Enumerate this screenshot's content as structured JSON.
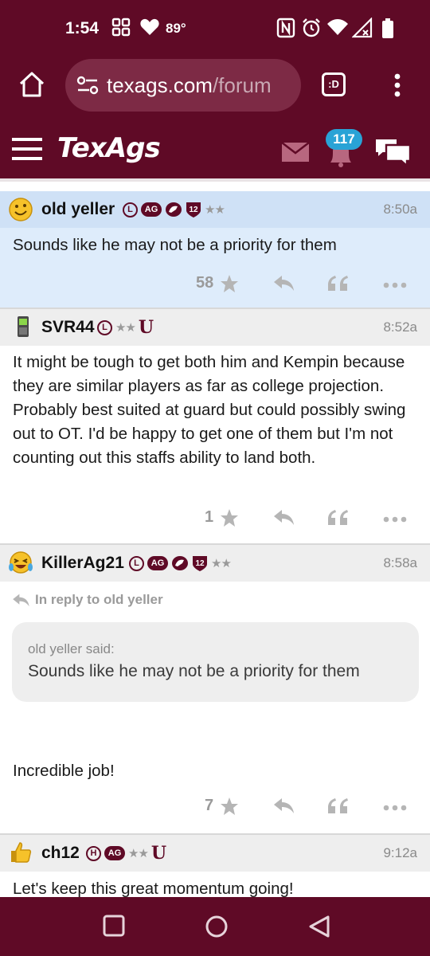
{
  "status_bar": {
    "time": "1:54",
    "temperature": "89°"
  },
  "browser": {
    "url_main": "texags.com",
    "url_rest": "/forum",
    "tab_label": ":D"
  },
  "site": {
    "logo": "TexAgs",
    "notification_count": "117"
  },
  "posts": [
    {
      "username": "old yeller",
      "time": "8:50a",
      "badges": [
        "L",
        "AG"
      ],
      "stars": "★★",
      "text": "Sounds like he may not be a priority for them",
      "likes": "58",
      "highlighted": true
    },
    {
      "username": "SVR44",
      "time": "8:52a",
      "badges": [
        "L"
      ],
      "stars": "★★",
      "text": "It might be tough to get both him and Kempin because they are similar players as far as college projection. Probably best suited at guard but could possibly swing out to OT. I'd be happy to get one of them but I'm not counting out this staffs ability to land both.",
      "likes": "1",
      "highlighted": false
    },
    {
      "username": "KillerAg21",
      "time": "8:58a",
      "badges": [
        "L",
        "AG"
      ],
      "stars": "★★",
      "reply_to": "In reply to old yeller",
      "quote_author": "old yeller said:",
      "quote_text": "Sounds like he may not be a priority for them",
      "text": "Incredible job!",
      "likes": "7",
      "highlighted": false
    },
    {
      "username": "ch12",
      "time": "9:12a",
      "badges": [
        "H",
        "AG"
      ],
      "stars": "★★",
      "text": "Let's keep this great momentum going!",
      "highlighted": false
    }
  ],
  "badge_misc": {
    "twelve": "12",
    "u": "U"
  },
  "colors": {
    "brand": "#5f0a26",
    "highlight": "#deecfb",
    "badge_blue": "#29a3d6"
  }
}
